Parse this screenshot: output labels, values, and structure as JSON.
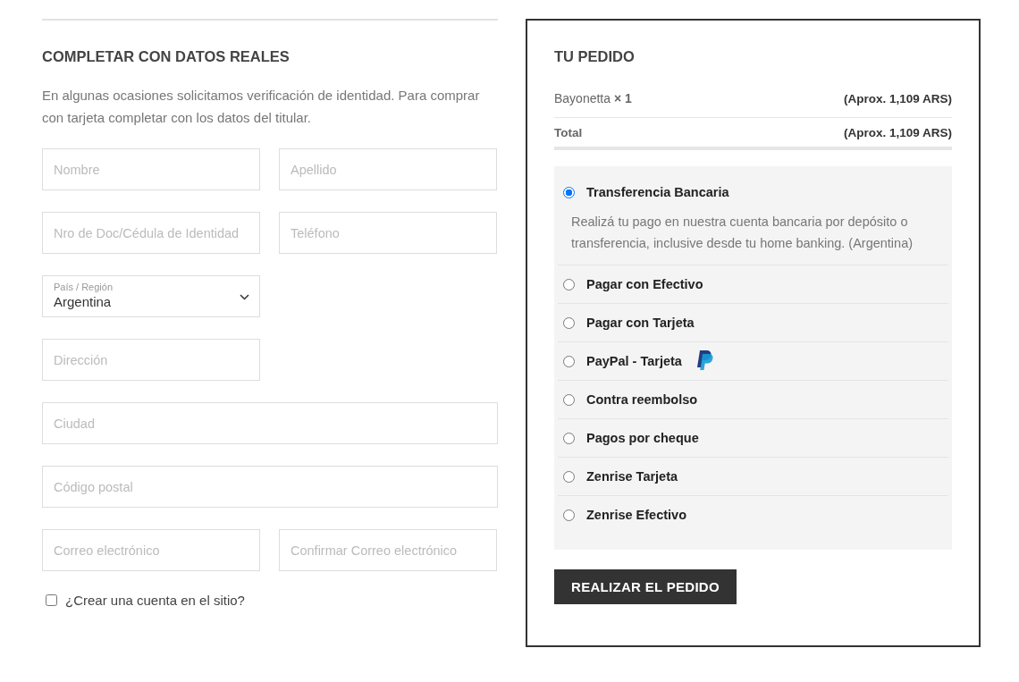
{
  "billing": {
    "title": "COMPLETAR CON DATOS REALES",
    "intro": "En algunas ocasiones solicitamos verificación de identidad. Para comprar con tarjeta completar con los datos del titular.",
    "rows": [
      {
        "fields": [
          {
            "kind": "input",
            "wide": false,
            "placeholder": "Nombre"
          },
          {
            "kind": "input",
            "wide": false,
            "placeholder": "Apellido"
          }
        ]
      },
      {
        "fields": [
          {
            "kind": "input",
            "wide": false,
            "placeholder": "Nro de Doc/Cédula de Identidad"
          },
          {
            "kind": "input",
            "wide": false,
            "placeholder": "Teléfono"
          }
        ]
      },
      {
        "fields": [
          {
            "kind": "select",
            "wide": false,
            "label": "País / Región",
            "value": "Argentina"
          }
        ]
      },
      {
        "fields": [
          {
            "kind": "input",
            "wide": false,
            "placeholder": "Dirección"
          }
        ]
      },
      {
        "fields": [
          {
            "kind": "input",
            "wide": true,
            "placeholder": "Ciudad"
          }
        ]
      },
      {
        "fields": [
          {
            "kind": "input",
            "wide": true,
            "placeholder": "Código postal"
          }
        ]
      },
      {
        "fields": [
          {
            "kind": "input",
            "wide": false,
            "placeholder": "Correo electrónico"
          },
          {
            "kind": "input",
            "wide": false,
            "placeholder": "Confirmar Correo electrónico"
          }
        ]
      }
    ],
    "create_account": {
      "label": "¿Crear una cuenta en el sitio?",
      "checked": false
    }
  },
  "order": {
    "title": "TU PEDIDO",
    "items": [
      {
        "name": "Bayonetta",
        "quantity": "× 1",
        "price": "(Aprox. 1,109 ARS)"
      }
    ],
    "total": {
      "label": "Total",
      "value": "(Aprox. 1,109 ARS)"
    },
    "payment_methods": [
      {
        "label": "Transferencia Bancaria",
        "selected": true,
        "kind": "plain",
        "description": "Realizá tu pago en nuestra cuenta bancaria por depósito o transferencia, inclusive desde tu home banking. (Argentina)"
      },
      {
        "label": "Pagar con Efectivo",
        "selected": false,
        "kind": "plain"
      },
      {
        "label": "Pagar con Tarjeta",
        "selected": false,
        "kind": "plain"
      },
      {
        "label": "PayPal - Tarjeta",
        "selected": false,
        "kind": "paypal"
      },
      {
        "label": "Contra reembolso",
        "selected": false,
        "kind": "plain"
      },
      {
        "label": "Pagos por cheque",
        "selected": false,
        "kind": "plain"
      },
      {
        "label": "Zenrise Tarjeta",
        "selected": false,
        "kind": "plain"
      },
      {
        "label": "Zenrise Efectivo",
        "selected": false,
        "kind": "plain"
      }
    ],
    "submit": "REALIZAR EL PEDIDO"
  }
}
